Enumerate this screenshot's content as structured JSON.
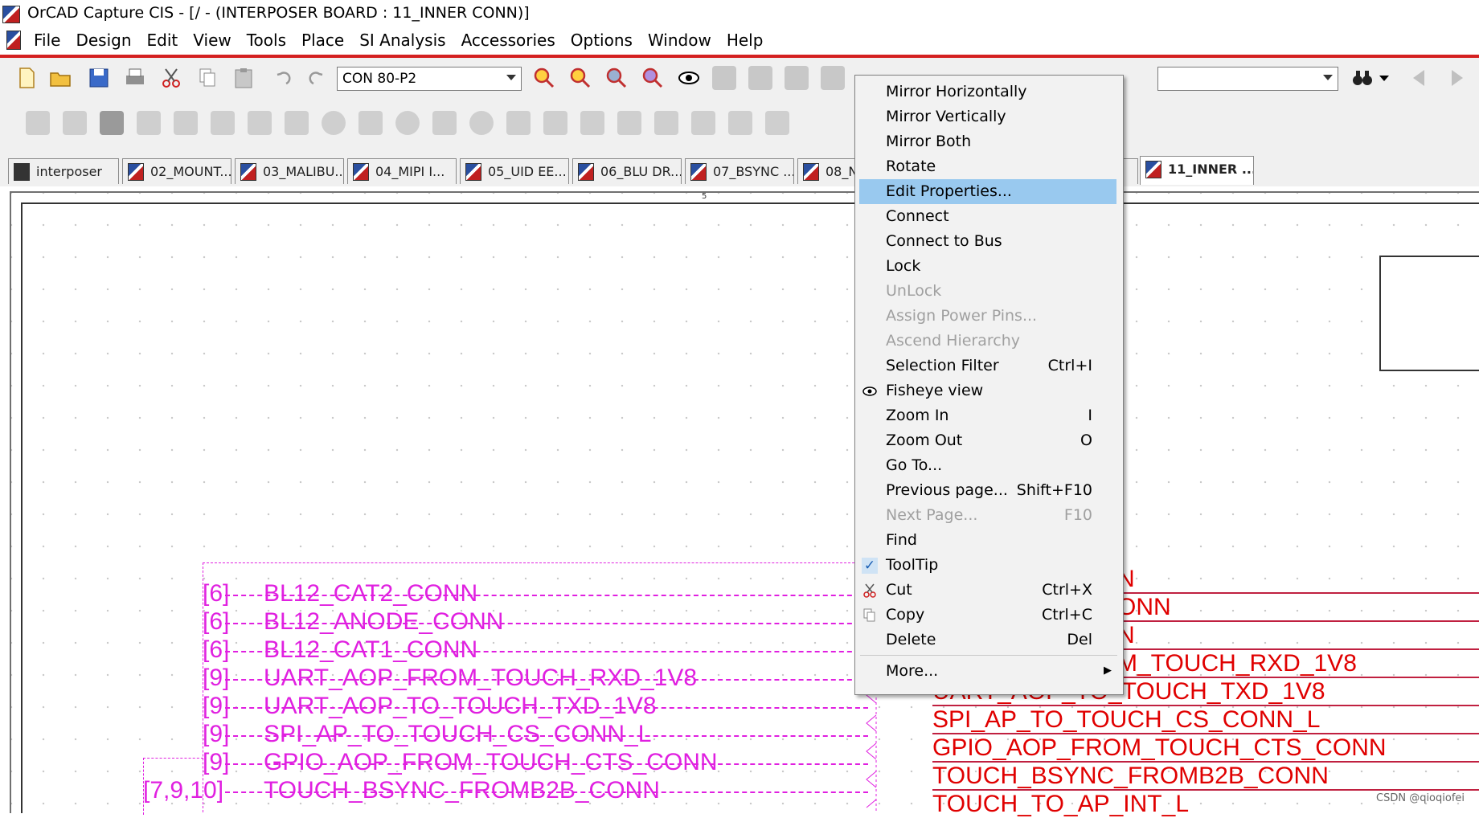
{
  "window": {
    "title": "OrCAD Capture CIS - [/ - (INTERPOSER BOARD : 11_INNER CONN)]"
  },
  "menubar": {
    "items": [
      "File",
      "Design",
      "Edit",
      "View",
      "Tools",
      "Place",
      "SI Analysis",
      "Accessories",
      "Options",
      "Window",
      "Help"
    ]
  },
  "toolbar": {
    "part_combo": "CON 80-P2",
    "search_combo": ""
  },
  "tabs": [
    {
      "label": "interposer"
    },
    {
      "label": "02_MOUNT..."
    },
    {
      "label": "03_MALIBU..."
    },
    {
      "label": "04_MIPI I..."
    },
    {
      "label": "05_UID EE..."
    },
    {
      "label": "06_BLU DR..."
    },
    {
      "label": "07_BSYNC ..."
    },
    {
      "label": "08_N"
    },
    {
      "label": "11_INNER ..."
    }
  ],
  "context_menu": {
    "items": [
      {
        "label": "Mirror Horizontally",
        "shortcut": "",
        "enabled": true
      },
      {
        "label": "Mirror Vertically",
        "shortcut": "",
        "enabled": true
      },
      {
        "label": "Mirror Both",
        "shortcut": "",
        "enabled": true
      },
      {
        "label": "Rotate",
        "shortcut": "",
        "enabled": true
      },
      {
        "label": "Edit Properties...",
        "shortcut": "",
        "enabled": true,
        "highlighted": true
      },
      {
        "label": "Connect",
        "shortcut": "",
        "enabled": true
      },
      {
        "label": "Connect to Bus",
        "shortcut": "",
        "enabled": true
      },
      {
        "label": "Lock",
        "shortcut": "",
        "enabled": true
      },
      {
        "label": "UnLock",
        "shortcut": "",
        "enabled": false
      },
      {
        "label": "Assign Power Pins...",
        "shortcut": "",
        "enabled": false
      },
      {
        "label": "Ascend Hierarchy",
        "shortcut": "",
        "enabled": false
      },
      {
        "label": "Selection Filter",
        "shortcut": "Ctrl+I",
        "enabled": true
      },
      {
        "label": "Fisheye view",
        "shortcut": "",
        "enabled": true,
        "icon": "eye-icon"
      },
      {
        "label": "Zoom In",
        "shortcut": "I",
        "enabled": true
      },
      {
        "label": "Zoom Out",
        "shortcut": "O",
        "enabled": true
      },
      {
        "label": "Go To...",
        "shortcut": "",
        "enabled": true
      },
      {
        "label": "Previous page...",
        "shortcut": "Shift+F10",
        "enabled": true
      },
      {
        "label": "Next Page...",
        "shortcut": "F10",
        "enabled": false
      },
      {
        "label": "Find",
        "shortcut": "",
        "enabled": true
      },
      {
        "label": "ToolTip",
        "shortcut": "",
        "enabled": true,
        "checked": true
      },
      {
        "label": "Cut",
        "shortcut": "Ctrl+X",
        "enabled": true,
        "icon": "scissors-icon"
      },
      {
        "label": "Copy",
        "shortcut": "Ctrl+C",
        "enabled": true,
        "icon": "copy-icon"
      },
      {
        "label": "Delete",
        "shortcut": "Del",
        "enabled": true
      },
      {
        "label": "More...",
        "shortcut": "",
        "enabled": true,
        "submenu": true
      }
    ]
  },
  "schematic": {
    "ruler_mark": "5",
    "left_nets": [
      {
        "ref": "[6]",
        "name": "BL12_CAT2_CONN"
      },
      {
        "ref": "[6]",
        "name": "BL12_ANODE_CONN"
      },
      {
        "ref": "[6]",
        "name": "BL12_CAT1_CONN"
      },
      {
        "ref": "[9]",
        "name": "UART_AOP_FROM_TOUCH_RXD_1V8"
      },
      {
        "ref": "[9]",
        "name": "UART_AOP_TO_TOUCH_TXD_1V8"
      },
      {
        "ref": "[9]",
        "name": "SPI_AP_TO_TOUCH_CS_CONN_L"
      },
      {
        "ref": "[9]",
        "name": "GPIO_AOP_FROM_TOUCH_CTS_CONN"
      },
      {
        "ref": "[7,9,10]",
        "name": "TOUCH_BSYNC_FROMB2B_CONN"
      }
    ],
    "right_nets": [
      "N",
      "ONN",
      "N",
      "M_TOUCH_RXD_1V8",
      "UART_AOP_TO_TOUCH_TXD_1V8",
      "SPI_AP_TO_TOUCH_CS_CONN_L",
      "GPIO_AOP_FROM_TOUCH_CTS_CONN",
      "TOUCH_BSYNC_FROMB2B_CONN",
      "TOUCH_TO_AP_INT_L"
    ]
  },
  "watermark": "CSDN @qioqiofei",
  "colors": {
    "menu_highlight": "#99c9ef",
    "net_left": "#e020e0",
    "net_right": "#e00000",
    "menubar_rule": "#d42020"
  }
}
